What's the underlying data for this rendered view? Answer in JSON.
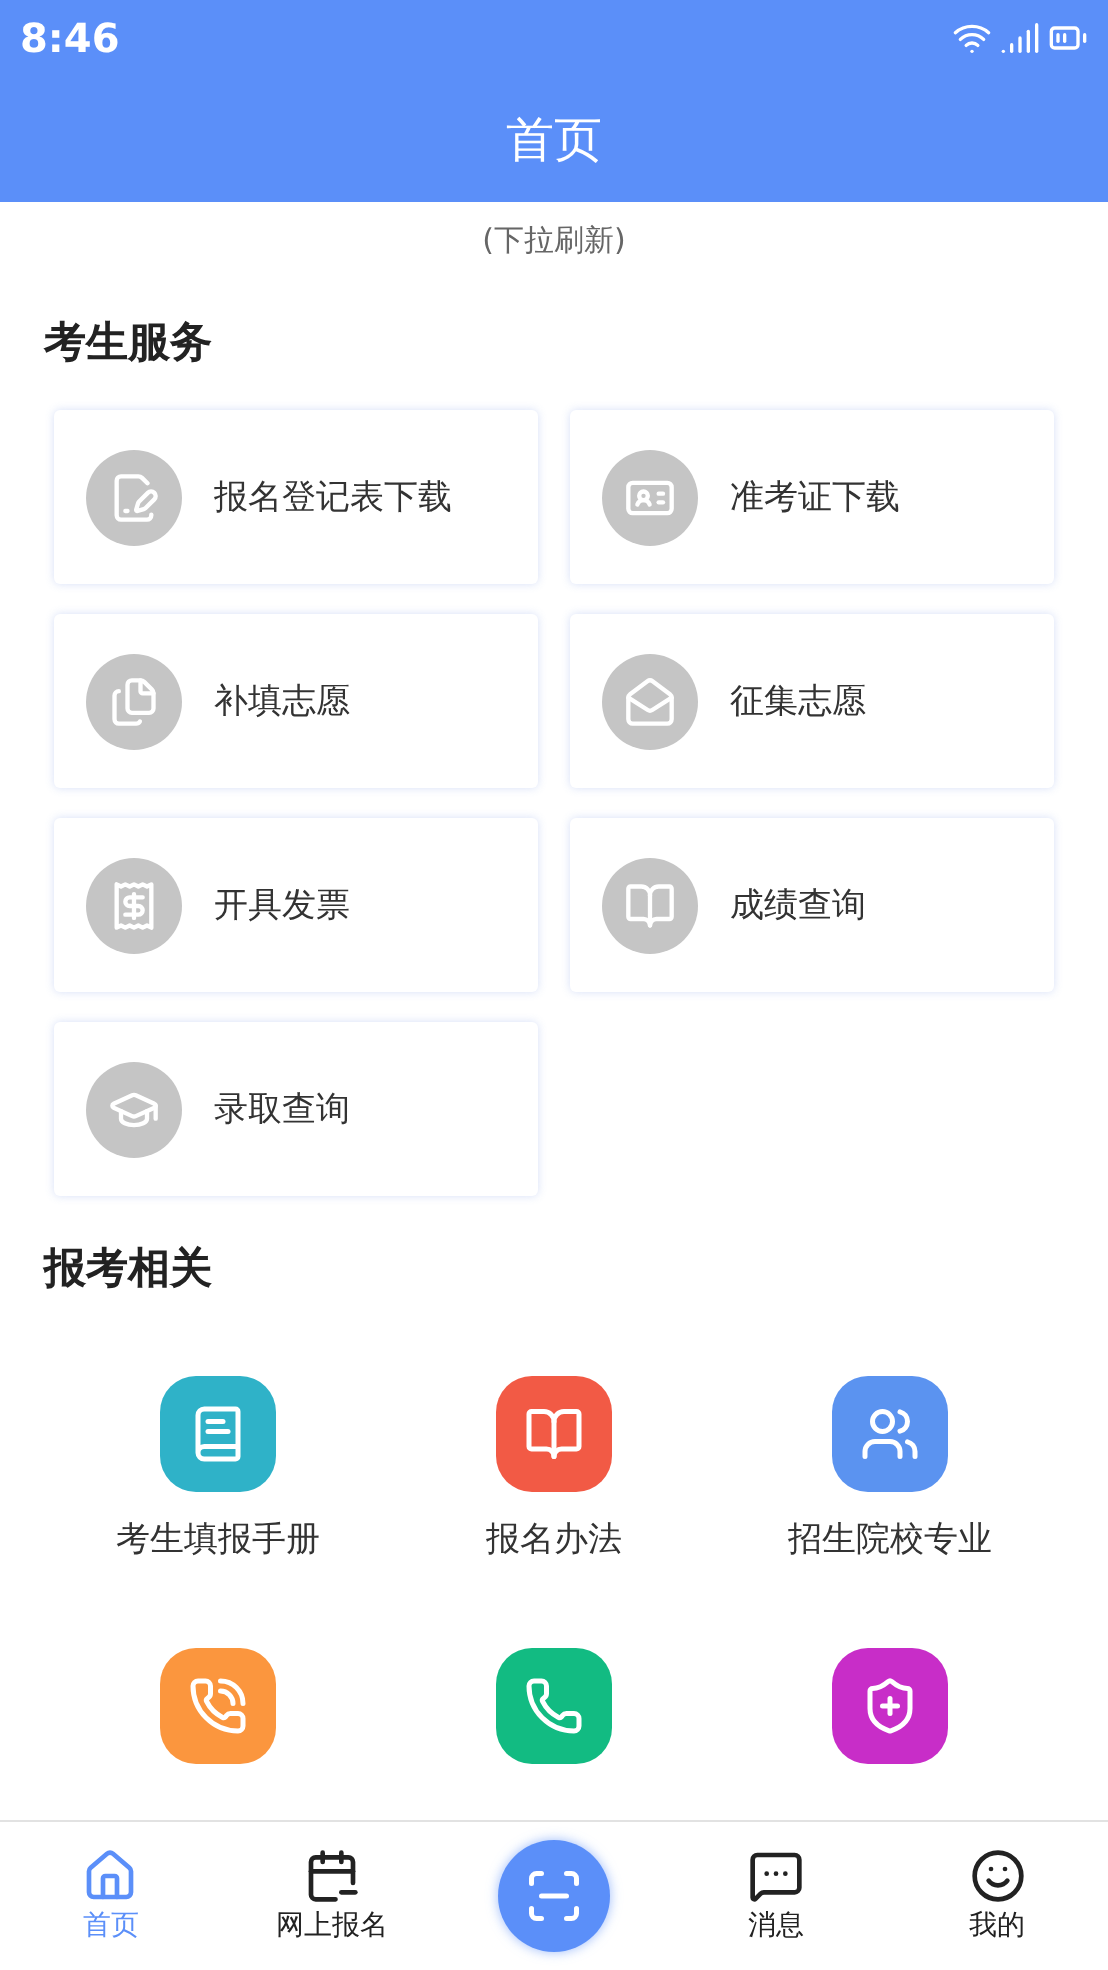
{
  "status_bar": {
    "time": "8:46"
  },
  "header": {
    "title": "首页"
  },
  "refresh_hint": "(下拉刷新)",
  "services": {
    "title": "考生服务",
    "items": [
      {
        "label": "报名登记表下载",
        "kind": "form"
      },
      {
        "label": "准考证下载",
        "kind": "idcard"
      },
      {
        "label": "补填志愿",
        "kind": "files"
      },
      {
        "label": "征集志愿",
        "kind": "mail"
      },
      {
        "label": "开具发票",
        "kind": "receipt"
      },
      {
        "label": "成绩查询",
        "kind": "book"
      },
      {
        "label": "录取查询",
        "kind": "cap"
      }
    ]
  },
  "related": {
    "title": "报考相关",
    "items": [
      {
        "label": "考生填报手册",
        "kind": "manual",
        "color": "#2fb2c8"
      },
      {
        "label": "报名办法",
        "kind": "book",
        "color": "#f25a45"
      },
      {
        "label": "招生院校专业",
        "kind": "people",
        "color": "#5b93f0"
      },
      {
        "kind": "phonecall",
        "color": "#fb963e"
      },
      {
        "kind": "phone",
        "color": "#12bb82"
      },
      {
        "kind": "shield",
        "color": "#c82dc8"
      }
    ]
  },
  "tabs": [
    {
      "label": "首页",
      "kind": "home",
      "selected": true
    },
    {
      "label": "网上报名",
      "kind": "calendar",
      "selected": false
    },
    {
      "kind": "scan",
      "selected": false
    },
    {
      "label": "消息",
      "kind": "message",
      "selected": false
    },
    {
      "label": "我的",
      "kind": "face",
      "selected": false
    }
  ]
}
